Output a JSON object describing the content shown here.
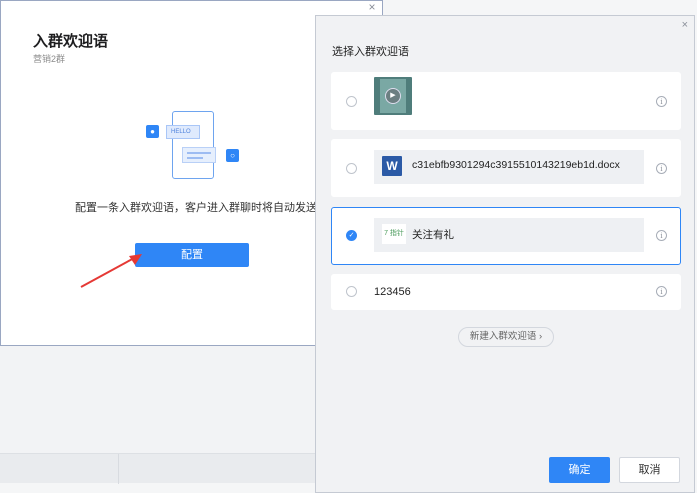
{
  "left_dialog": {
    "close": "×",
    "title": "入群欢迎语",
    "subtitle": "营销2群",
    "illustration_hello": "HELLO",
    "description": "配置一条入群欢迎语，客户进入群聊时将自动发送",
    "config_button": "配置"
  },
  "right_panel": {
    "close": "×",
    "title": "选择入群欢迎语",
    "items": [
      {
        "type": "video",
        "selected": false,
        "info": "i"
      },
      {
        "type": "file",
        "icon_text": "W",
        "text": "c31ebfb9301294c3915510143219eb1d.docx",
        "selected": false,
        "info": "i"
      },
      {
        "type": "link",
        "logo_text": "7 指针",
        "text": "关注有礼",
        "selected": true,
        "info": "i"
      },
      {
        "type": "text",
        "text": "123456",
        "selected": false,
        "info": "i"
      }
    ],
    "new_link": "新建入群欢迎语 ›",
    "ok_button": "确定",
    "cancel_button": "取消"
  },
  "colors": {
    "primary": "#2f86f6",
    "arrow": "#e53935"
  }
}
